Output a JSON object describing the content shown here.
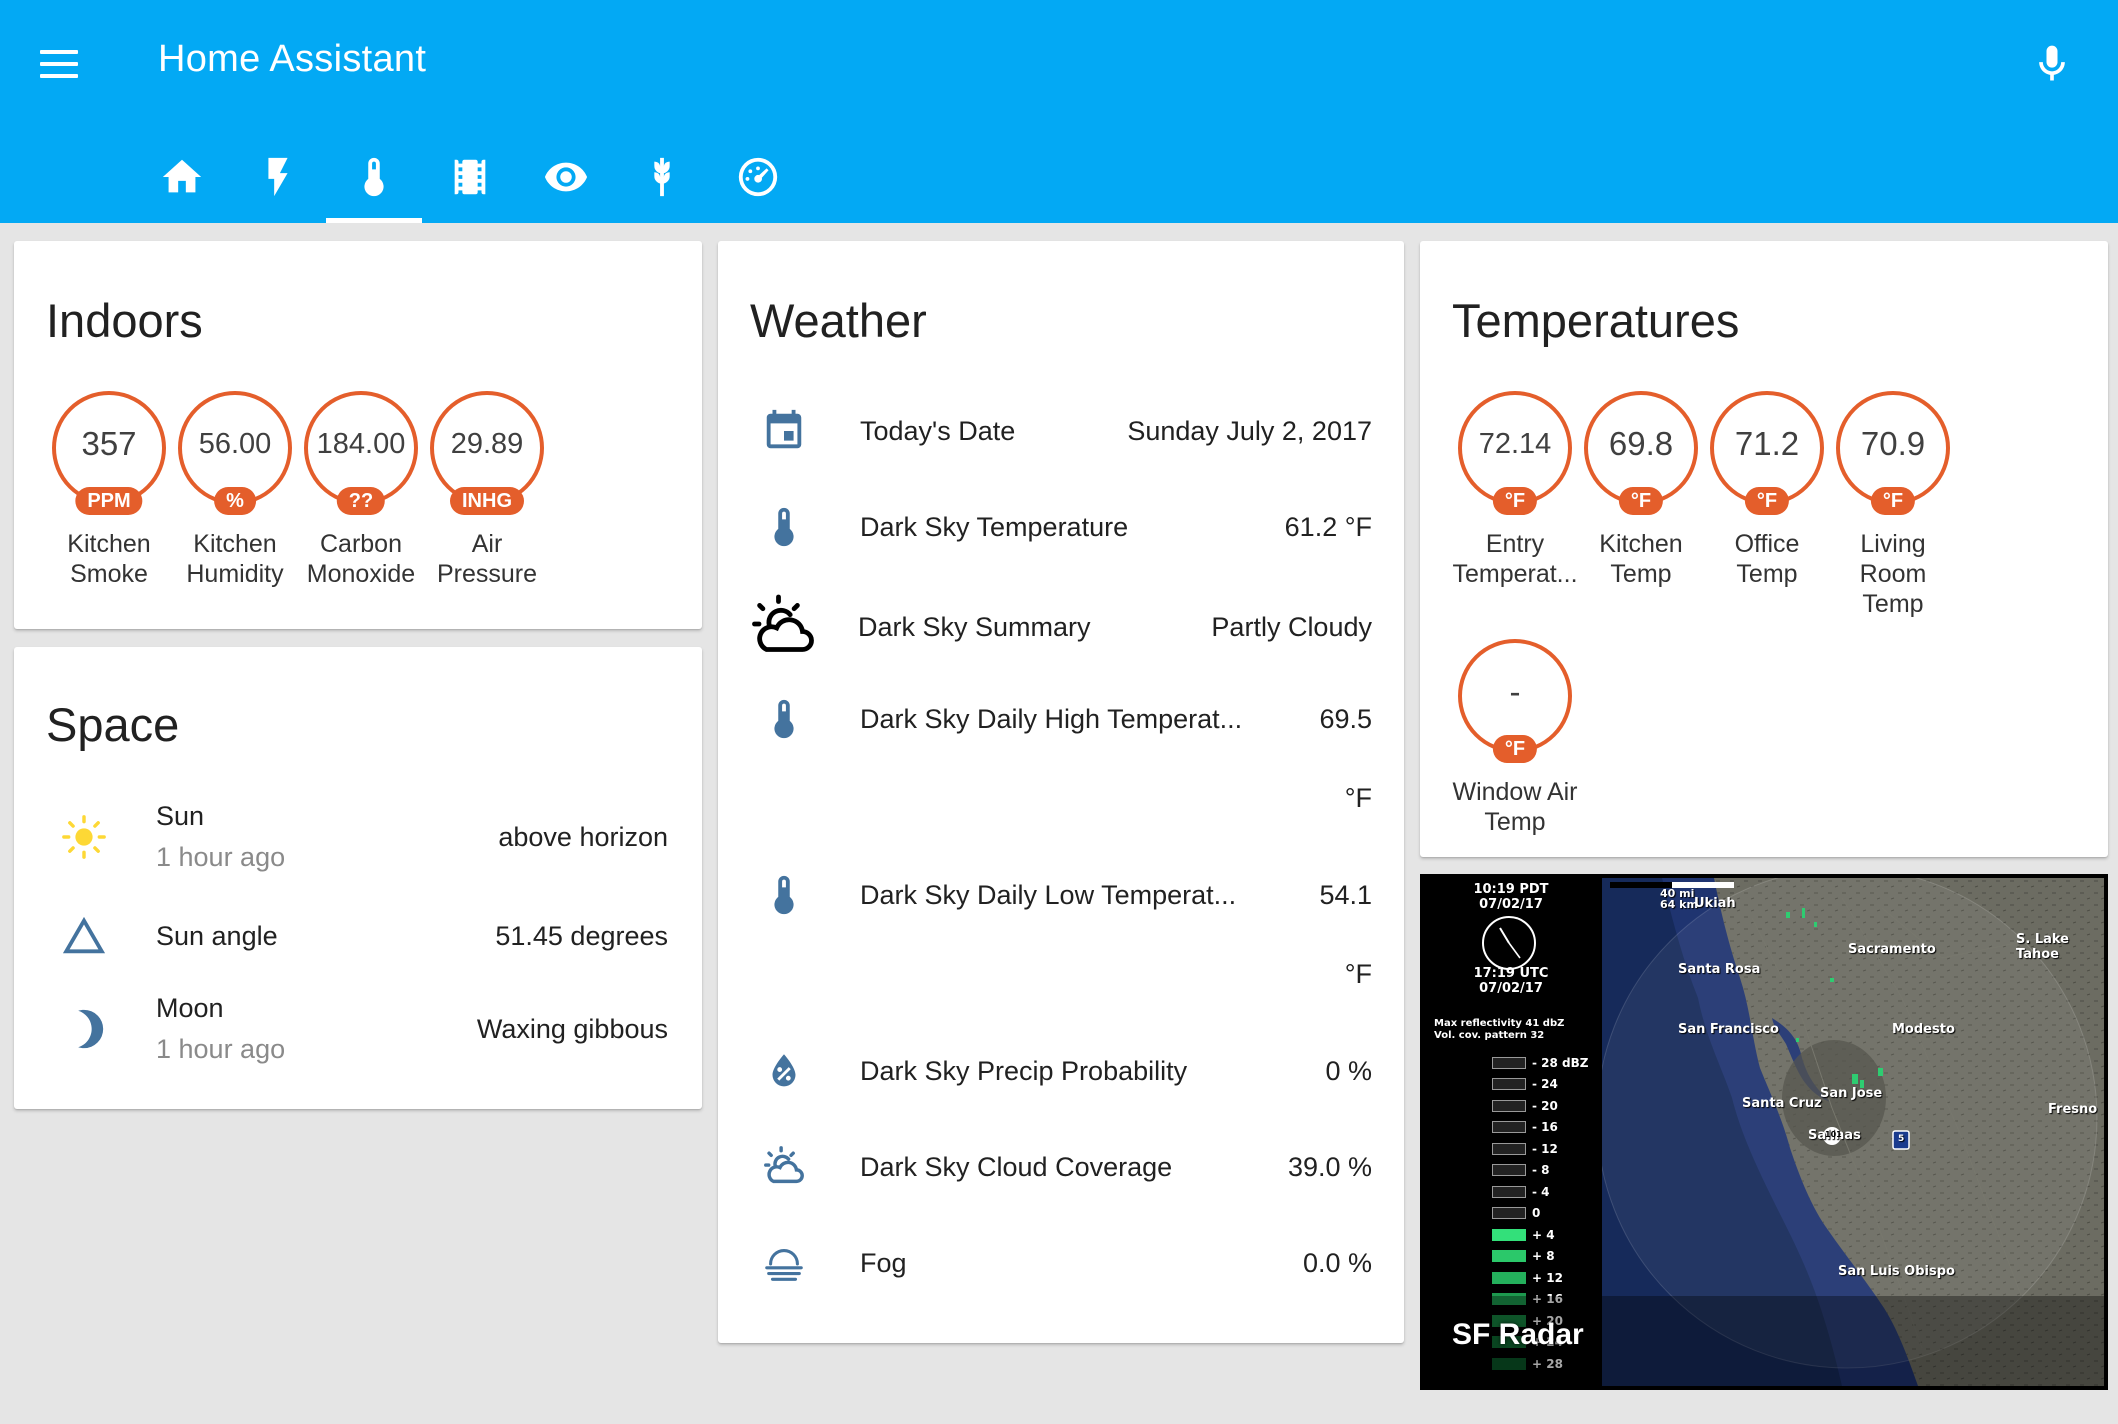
{
  "header": {
    "title": "Home Assistant",
    "tabs": [
      "home-icon",
      "flash-icon",
      "thermometer-icon",
      "film-icon",
      "eye-icon",
      "barley-icon",
      "gauge-icon"
    ],
    "active_tab": 2
  },
  "colors": {
    "header": "#03a9f4",
    "badge_accent": "#e45e2b",
    "icon_blue": "#44739e",
    "sun": "#fdd835"
  },
  "indoors": {
    "title": "Indoors",
    "badges": [
      {
        "value": "357",
        "unit": "PPM",
        "label": "Kitchen Smoke"
      },
      {
        "value": "56.00",
        "unit": "%",
        "label": "Kitchen Humidity"
      },
      {
        "value": "184.00",
        "unit": "??",
        "label": "Carbon Monoxide"
      },
      {
        "value": "29.89",
        "unit": "INHG",
        "label": "Air Pressure"
      }
    ]
  },
  "space": {
    "title": "Space",
    "rows": [
      {
        "icon": "sun-icon",
        "name": "Sun",
        "sub": "1 hour ago",
        "value": "above horizon"
      },
      {
        "icon": "triangle-icon",
        "name": "Sun angle",
        "value": "51.45 degrees"
      },
      {
        "icon": "moon-icon",
        "name": "Moon",
        "sub": "1 hour ago",
        "value": "Waxing gibbous"
      }
    ]
  },
  "weather": {
    "title": "Weather",
    "rows": [
      {
        "icon": "calendar-icon",
        "name": "Today's Date",
        "value": "Sunday July 2, 2017"
      },
      {
        "icon": "thermometer-icon",
        "name": "Dark Sky Temperature",
        "value": "61.2 °F"
      },
      {
        "icon": "partly-cloudy-icon",
        "name": "Dark Sky Summary",
        "value": "Partly Cloudy"
      },
      {
        "icon": "thermometer-icon",
        "name": "Dark Sky Daily High Temperat...",
        "value": "69.5",
        "unit": "°F"
      },
      {
        "icon": "thermometer-icon",
        "name": "Dark Sky Daily Low Temperat...",
        "value": "54.1",
        "unit": "°F"
      },
      {
        "icon": "water-percent-icon",
        "name": "Dark Sky Precip Probability",
        "value": "0 %"
      },
      {
        "icon": "cloud-coverage-icon",
        "name": "Dark Sky Cloud Coverage",
        "value": "39.0 %"
      },
      {
        "icon": "fog-icon",
        "name": "Fog",
        "value": "0.0 %"
      }
    ]
  },
  "temperatures": {
    "title": "Temperatures",
    "badges": [
      {
        "value": "72.14",
        "unit": "°F",
        "label": "Entry Temperat..."
      },
      {
        "value": "69.8",
        "unit": "°F",
        "label": "Kitchen Temp"
      },
      {
        "value": "71.2",
        "unit": "°F",
        "label": "Office Temp"
      },
      {
        "value": "70.9",
        "unit": "°F",
        "label": "Living Room Temp"
      },
      {
        "value": "-",
        "unit": "°F",
        "label": "Window Air Temp"
      }
    ]
  },
  "radar": {
    "caption": "SF Radar",
    "local_time": "10:19  PDT",
    "local_date": "07/02/17",
    "utc_time": "17:19  UTC",
    "utc_date": "07/02/17",
    "info_line1": "Max reflectivity  41 dbZ",
    "info_line2": "Vol. cov. pattern  32",
    "scale": [
      "- 28  dBZ",
      "- 24",
      "- 20",
      "- 16",
      "- 12",
      "- 8",
      "- 4",
      "0",
      "+ 4",
      "+ 8",
      "+ 12",
      "+ 16",
      "+ 20",
      "+ 24",
      "+ 28"
    ],
    "scale_bar_label_top": "40  mi",
    "scale_bar_label_bottom": "64  km",
    "places": [
      "Ukiah",
      "S. Lake Tahoe",
      "Sacramento",
      "Santa Rosa",
      "San Francisco",
      "Modesto",
      "San Jose",
      "Santa Cruz",
      "Fresno",
      "Salinas",
      "San Luis Obispo"
    ],
    "highway_labels": [
      "101",
      "5"
    ]
  }
}
